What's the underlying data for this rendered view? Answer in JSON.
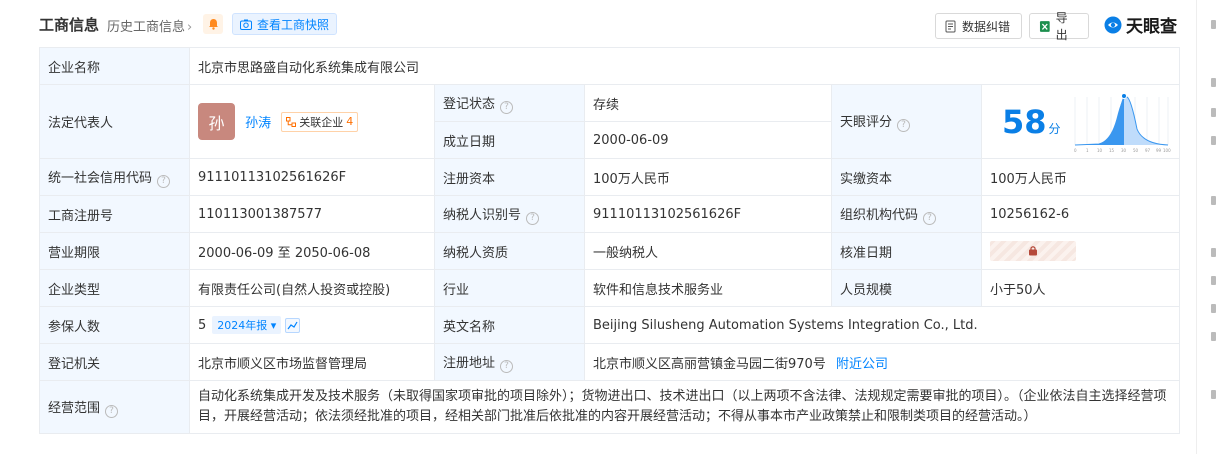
{
  "header": {
    "title": "工商信息",
    "history": "历史工商信息",
    "snapshot": "查看工商快照",
    "correct": "数据纠错",
    "export": "导出",
    "logo": "天眼查"
  },
  "rows": {
    "company_name_label": "企业名称",
    "company_name": "北京市思路盛自动化系统集成有限公司",
    "legal_rep_label": "法定代表人",
    "avatar_char": "孙",
    "legal_rep_name": "孙涛",
    "assoc_label": "关联企业",
    "assoc_count": "4",
    "reg_status_label": "登记状态",
    "reg_status": "存续",
    "found_date_label": "成立日期",
    "found_date": "2000-06-09",
    "score_label": "天眼评分",
    "score": "58",
    "score_unit": "分",
    "credit_code_label": "统一社会信用代码",
    "credit_code": "91110113102561626F",
    "reg_capital_label": "注册资本",
    "reg_capital": "100万人民币",
    "paid_capital_label": "实缴资本",
    "paid_capital": "100万人民币",
    "reg_no_label": "工商注册号",
    "reg_no": "110113001387577",
    "taxpayer_id_label": "纳税人识别号",
    "taxpayer_id": "91110113102561626F",
    "org_code_label": "组织机构代码",
    "org_code": "10256162-6",
    "term_label": "营业期限",
    "term": "2000-06-09 至 2050-06-08",
    "taxpayer_qual_label": "纳税人资质",
    "taxpayer_qual": "一般纳税人",
    "approve_date_label": "核准日期",
    "type_label": "企业类型",
    "type": "有限责任公司(自然人投资或控股)",
    "industry_label": "行业",
    "industry": "软件和信息技术服务业",
    "staff_label": "人员规模",
    "staff": "小于50人",
    "insured_label": "参保人数",
    "insured": "5",
    "insured_year": "2024年报",
    "en_name_label": "英文名称",
    "en_name": "Beijing Silusheng Automation Systems Integration Co., Ltd.",
    "authority_label": "登记机关",
    "authority": "北京市顺义区市场监督管理局",
    "address_label": "注册地址",
    "address": "北京市顺义区高丽营镇金马园二街970号",
    "nearby": "附近公司",
    "scope_label": "经营范围",
    "scope": "自动化系统集成开发及技术服务（未取得国家项审批的项目除外）；货物进出口、技术进出口（以上两项不含法律、法规规定需要审批的项目）。（企业依法自主选择经营项目，开展经营活动；依法须经批准的项目，经相关部门批准后依批准的内容开展经营活动；不得从事本市产业政策禁止和限制类项目的经营活动。）"
  },
  "score_axis": [
    "0",
    "1",
    "10",
    "15",
    "30",
    "50",
    "97",
    "99",
    "100"
  ],
  "colors": {
    "accent": "#0084ff",
    "label_bg": "#f2f8ff",
    "status_green": "#19a15f"
  }
}
